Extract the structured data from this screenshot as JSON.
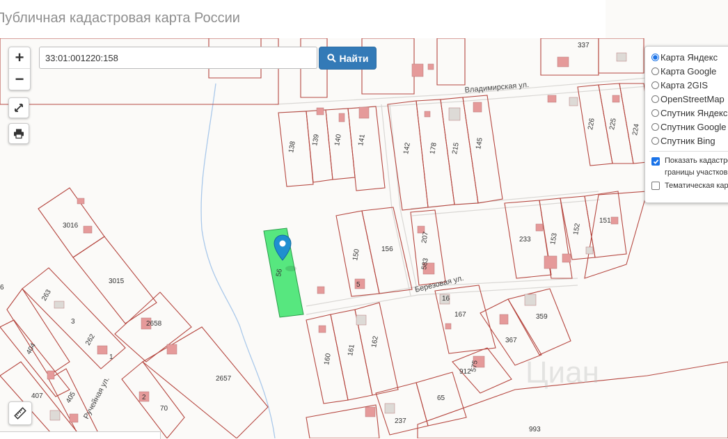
{
  "app": {
    "title": "Публичная кадастровая карта России"
  },
  "search": {
    "value": "33:01:001220:158",
    "button_label": "Найти"
  },
  "zoom": {
    "in_label": "+",
    "out_label": "−"
  },
  "layers": {
    "base": [
      {
        "label": "Карта Яндекс",
        "selected": true
      },
      {
        "label": "Карта Google",
        "selected": false
      },
      {
        "label": "Карта 2GIS",
        "selected": false
      },
      {
        "label": "OpenStreetMap",
        "selected": false
      },
      {
        "label": "Спутник Яндекс",
        "selected": false
      },
      {
        "label": "Спутник Google",
        "selected": false
      },
      {
        "label": "Спутник Bing",
        "selected": false
      }
    ],
    "overlays": [
      {
        "label_line1": "Показать кадастровые",
        "label_line2": "границы участков",
        "checked": true
      },
      {
        "label_line1": "Тематическая карта",
        "checked": false
      }
    ]
  },
  "map": {
    "streets": [
      "Владимирская ул.",
      "Березовая ул.",
      "Ручейная ул."
    ],
    "parcel_numbers": [
      "337",
      "138",
      "139",
      "140",
      "141",
      "142",
      "178",
      "215",
      "145",
      "226",
      "225",
      "224",
      "3016",
      "3015",
      "150",
      "156",
      "207",
      "583",
      "233",
      "153",
      "152",
      "151",
      "263",
      "3",
      "262",
      "1",
      "2658",
      "167",
      "359",
      "16",
      "5",
      "404",
      "407",
      "405",
      "2",
      "70",
      "2657",
      "160",
      "161",
      "162",
      "367",
      "912",
      "575",
      "65",
      "237",
      "993",
      "6"
    ],
    "selected_parcel_label": "56",
    "watermark": "Циан"
  },
  "colors": {
    "parcel_stroke": "#b5463f",
    "selected_fill": "#39e36a",
    "building": "#e59a9a",
    "water": "#a9c8ea",
    "button": "#337ab7"
  }
}
